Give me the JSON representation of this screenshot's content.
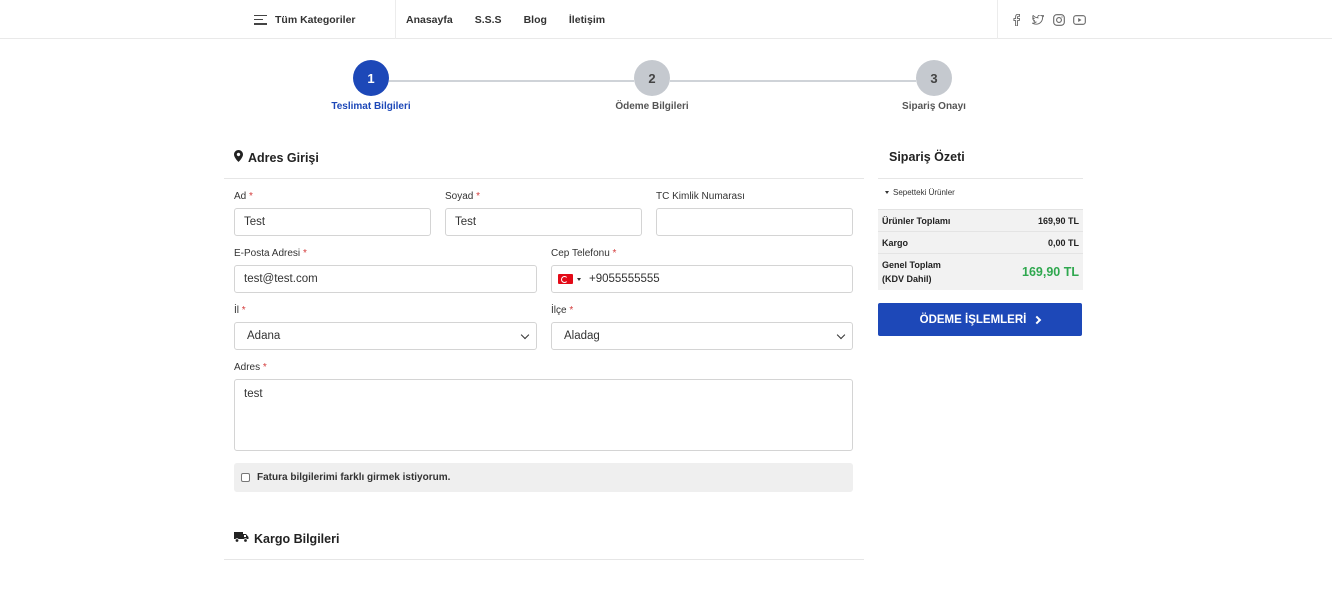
{
  "nav": {
    "categories_label": "Tüm Kategoriler",
    "links": [
      "Anasayfa",
      "S.S.S",
      "Blog",
      "İletişim"
    ],
    "social_icons": [
      "facebook-icon",
      "twitter-icon",
      "instagram-icon",
      "youtube-icon"
    ]
  },
  "stepper": {
    "steps": [
      {
        "number": "1",
        "label": "Teslimat Bilgileri",
        "active": true
      },
      {
        "number": "2",
        "label": "Ödeme Bilgileri",
        "active": false
      },
      {
        "number": "3",
        "label": "Sipariş Onayı",
        "active": false
      }
    ]
  },
  "address": {
    "title": "Adres Girişi",
    "first_name": {
      "label": "Ad",
      "required": "*",
      "value": "Test"
    },
    "last_name": {
      "label": "Soyad",
      "required": "*",
      "value": "Test"
    },
    "tc_id": {
      "label": "TC Kimlik Numarası",
      "value": ""
    },
    "email": {
      "label": "E-Posta Adresi",
      "required": "*",
      "value": "test@test.com"
    },
    "phone": {
      "label": "Cep Telefonu",
      "required": "*",
      "value": "+9055555555"
    },
    "city": {
      "label": "İl",
      "required": "*",
      "value": "Adana"
    },
    "district": {
      "label": "İlçe",
      "required": "*",
      "value": "Aladag"
    },
    "address": {
      "label": "Adres",
      "required": "*",
      "value": "test"
    },
    "invoice_checkbox_label": "Fatura bilgilerimi farklı girmek istiyorum."
  },
  "shipping": {
    "title": "Kargo Bilgileri"
  },
  "summary": {
    "title": "Sipariş Özeti",
    "toggle_label": "Sepetteki Ürünler",
    "products_total_label": "Ürünler Toplamı",
    "products_total_value": "169,90 TL",
    "shipping_label": "Kargo",
    "shipping_value": "0,00 TL",
    "grand_total_label_1": "Genel Toplam",
    "grand_total_label_2": "(KDV Dahil)",
    "grand_total_value": "169,90 TL",
    "pay_button": "ÖDEME İŞLEMLERİ"
  },
  "colors": {
    "primary": "#1d48b8",
    "success": "#2fa84f",
    "required": "#d43c3c"
  }
}
